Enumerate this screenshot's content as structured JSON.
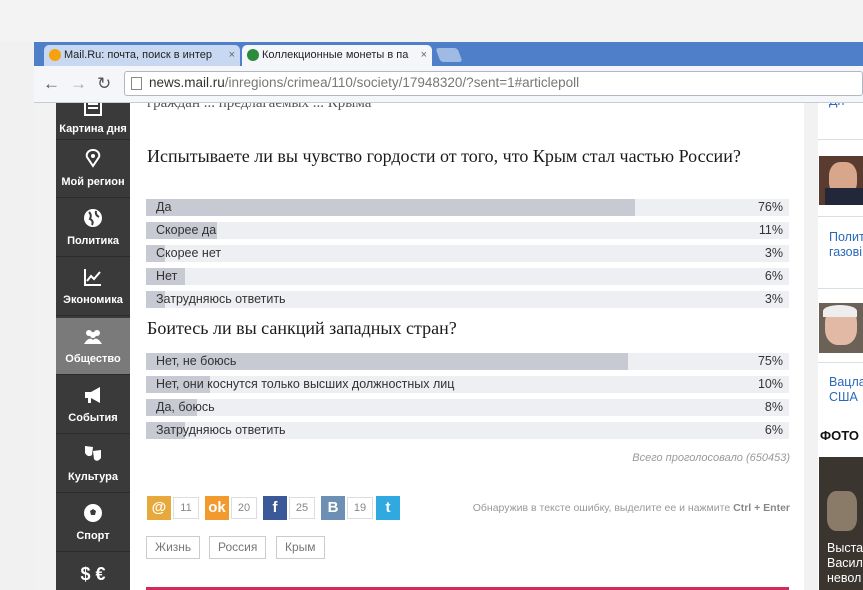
{
  "browser": {
    "tabs": [
      {
        "title": "Mail.Ru: почта, поиск в интер",
        "close": "×"
      },
      {
        "title": "Коллекционные монеты в па",
        "close": "×"
      }
    ],
    "nav": {
      "back": "←",
      "forward": "→",
      "reload": "↻"
    },
    "url_host": "news.mail.ru",
    "url_path": "/inregions/crimea/110/society/17948320/?sent=1#articlepoll"
  },
  "sidebar": {
    "items": [
      {
        "label": "Картина дня",
        "icon": "newspaper-icon"
      },
      {
        "label": "Мой регион",
        "icon": "map-pin-icon"
      },
      {
        "label": "Политика",
        "icon": "globe-icon"
      },
      {
        "label": "Экономика",
        "icon": "chart-icon"
      },
      {
        "label": "Общество",
        "icon": "people-icon",
        "active": true
      },
      {
        "label": "События",
        "icon": "megaphone-icon"
      },
      {
        "label": "Культура",
        "icon": "theater-masks-icon"
      },
      {
        "label": "Спорт",
        "icon": "soccer-ball-icon"
      },
      {
        "label": "",
        "icon": "currency-icon",
        "glyph": "$ €"
      }
    ]
  },
  "article": {
    "cut_text": "граждан ... предлагаемых ... Крыма",
    "cut_link": "Крыма"
  },
  "polls": [
    {
      "question": "Испытываете ли вы чувство гордости от того, что Крым стал частью России?",
      "options": [
        {
          "label": "Да",
          "percent": "76%",
          "value": 76
        },
        {
          "label": "Скорее да",
          "percent": "11%",
          "value": 11
        },
        {
          "label": "Скорее нет",
          "percent": "3%",
          "value": 3
        },
        {
          "label": "Нет",
          "percent": "6%",
          "value": 6
        },
        {
          "label": "Затрудняюсь ответить",
          "percent": "3%",
          "value": 3
        }
      ]
    },
    {
      "question": "Боитесь ли вы санкций западных стран?",
      "options": [
        {
          "label": "Нет, не боюсь",
          "percent": "75%",
          "value": 75
        },
        {
          "label": "Нет, они коснутся только высших должностных лиц",
          "percent": "10%",
          "value": 10
        },
        {
          "label": "Да, боюсь",
          "percent": "8%",
          "value": 8
        },
        {
          "label": "Затрудняюсь ответить",
          "percent": "6%",
          "value": 6
        }
      ]
    }
  ],
  "total_votes": "Всего проголосовало (650453)",
  "share": {
    "mailru": {
      "glyph": "@",
      "count": "11",
      "color": "#e8a93c"
    },
    "ok": {
      "glyph": "ok",
      "count": "20",
      "color": "#f39a2f"
    },
    "facebook": {
      "glyph": "f",
      "count": "25",
      "color": "#3b5998"
    },
    "vk": {
      "glyph": "В",
      "count": "19",
      "color": "#6d8fb3"
    },
    "twitter": {
      "glyph": "t",
      "color": "#2fa9e0"
    }
  },
  "error_hint": {
    "text": "Обнаружив в тексте ошибку, выделите ее и нажмите",
    "keys": "Ctrl + Enter"
  },
  "tags": [
    "Жизнь",
    "Россия",
    "Крым"
  ],
  "right_column": {
    "link1": "Дн",
    "link2_lines": [
      "Полит",
      "газові"
    ],
    "link3_lines": [
      "Вацла",
      "США"
    ],
    "heading": "ФОТО",
    "photo_caption_lines": [
      "Выста",
      "Васил",
      "невол"
    ]
  }
}
